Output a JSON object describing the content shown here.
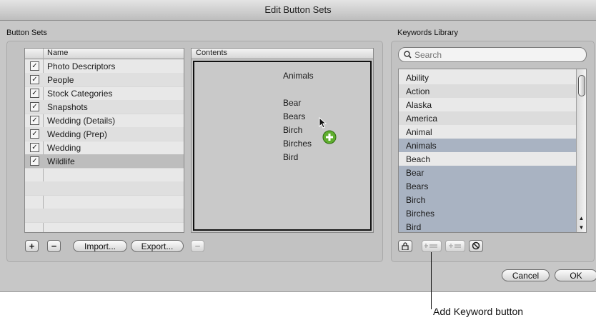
{
  "window": {
    "title": "Edit Button Sets"
  },
  "button_sets": {
    "section_label": "Button Sets",
    "name_header": "Name",
    "rows": [
      {
        "label": "Photo Descriptors",
        "checked": true
      },
      {
        "label": "People",
        "checked": true
      },
      {
        "label": "Stock Categories",
        "checked": true
      },
      {
        "label": "Snapshots",
        "checked": true
      },
      {
        "label": "Wedding (Details)",
        "checked": true
      },
      {
        "label": "Wedding (Prep)",
        "checked": true
      },
      {
        "label": "Wedding",
        "checked": true
      },
      {
        "label": "Wildlife",
        "checked": true
      }
    ],
    "add_label": "+",
    "remove_label": "−",
    "import_label": "Import...",
    "export_label": "Export..."
  },
  "contents": {
    "header": "Contents",
    "items": [
      "Animals",
      "",
      "Bear",
      "Bears",
      "Birch",
      "Birches",
      "Bird"
    ],
    "remove_label": "−"
  },
  "keywords_library": {
    "section_label": "Keywords Library",
    "search_placeholder": "Search",
    "items": [
      {
        "label": "Ability",
        "highlighted": false
      },
      {
        "label": "Action",
        "highlighted": false
      },
      {
        "label": "Alaska",
        "highlighted": false
      },
      {
        "label": "America",
        "highlighted": false
      },
      {
        "label": "Animal",
        "highlighted": false
      },
      {
        "label": "Animals",
        "highlighted": true
      },
      {
        "label": "Beach",
        "highlighted": false
      },
      {
        "label": "Bear",
        "highlighted": true
      },
      {
        "label": "Bears",
        "highlighted": true
      },
      {
        "label": "Birch",
        "highlighted": true
      },
      {
        "label": "Birches",
        "highlighted": true
      },
      {
        "label": "Bird",
        "highlighted": true
      }
    ]
  },
  "dialog_buttons": {
    "cancel_label": "Cancel",
    "ok_label": "OK"
  },
  "callout": {
    "text": "Add Keyword button"
  },
  "colors": {
    "accent_green": "#5fae2e",
    "highlight_row": "#a9b3c2"
  }
}
